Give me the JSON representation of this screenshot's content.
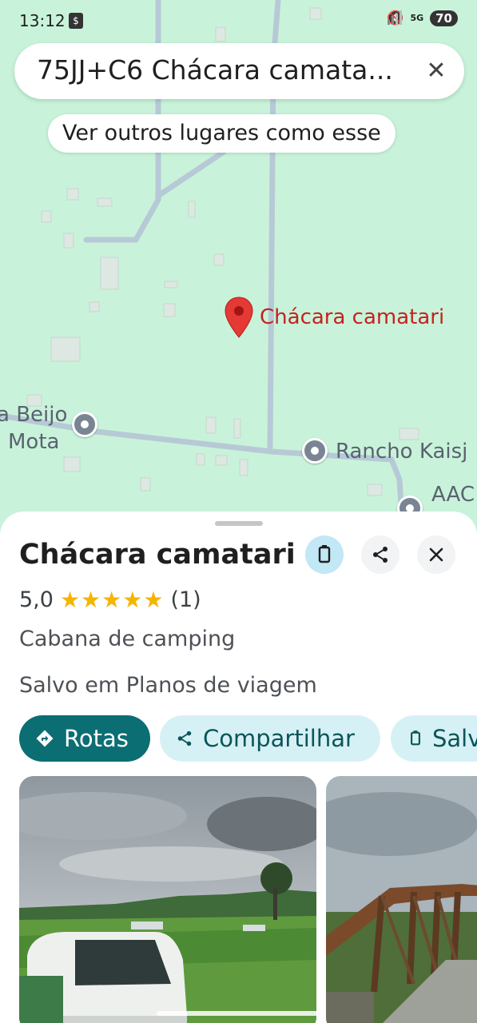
{
  "status_bar": {
    "time": "13:12",
    "battery": "70",
    "network": "5G"
  },
  "search": {
    "query": "75JJ+C6 Chácara camata..."
  },
  "map": {
    "similar_places_chip": "Ver outros lugares como esse",
    "selected_place_label": "Chácara camatari",
    "labels": {
      "beijo": "a Beijo",
      "mota": "Mota",
      "rancho": "Rancho Kaisj",
      "aac": "AAC"
    }
  },
  "place": {
    "name": "Chácara camatari",
    "rating": "5,0",
    "stars": "★★★★★",
    "review_count": "(1)",
    "category": "Cabana de camping",
    "saved_in": "Salvo em Planos de viagem"
  },
  "actions": {
    "directions": "Rotas",
    "share": "Compartilhar",
    "save": "Salvo"
  },
  "icons": {
    "mute": "mute-icon",
    "search_close": "close-icon",
    "pin": "red-pin-icon",
    "poi": "poi-icon",
    "saved": "bookmark-icon",
    "share": "share-icon",
    "close": "close-icon",
    "directions": "directions-icon"
  },
  "colors": {
    "map_background": "#c8f3da",
    "pin": "#e53935",
    "primary_action": "#0b6e73",
    "secondary_action": "#d6f1f5",
    "stars": "#f6b400"
  }
}
